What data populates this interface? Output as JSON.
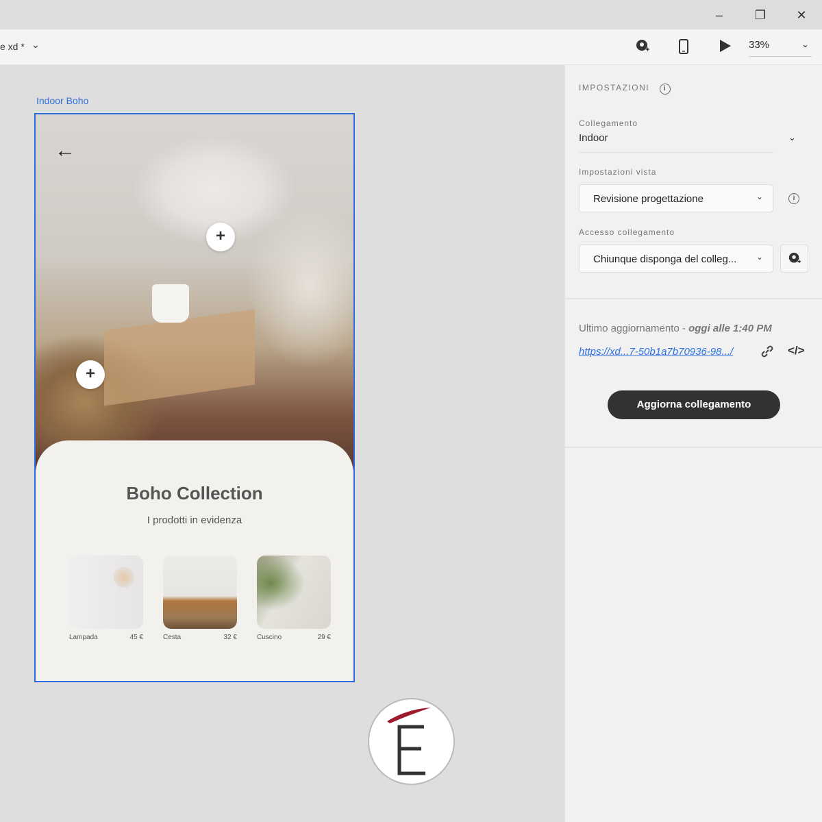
{
  "window": {
    "minimize": "–",
    "restore": "❐",
    "close": "✕"
  },
  "toolbar": {
    "doc_title": "e xd *",
    "doc_chevron": "⌄",
    "zoom": "33%",
    "zoom_chevron": "⌄"
  },
  "canvas": {
    "artboard_label": "Indoor Boho",
    "back_arrow": "←",
    "hotspot": "+",
    "title": "Boho Collection",
    "subtitle": "I prodotti in evidenza",
    "products": [
      {
        "name": "Lampada",
        "price": "45 €"
      },
      {
        "name": "Cesta",
        "price": "32 €"
      },
      {
        "name": "Cuscino",
        "price": "29 €"
      }
    ]
  },
  "panel": {
    "section_title": "IMPOSTAZIONI",
    "link_label": "Collegamento",
    "link_value": "Indoor",
    "view_label": "Impostazioni vista",
    "view_value": "Revisione progettazione",
    "access_label": "Accesso collegamento",
    "access_value": "Chiunque disponga del colleg...",
    "last_update": "Ultimo aggiornamento - ",
    "last_update_time": "oggi alle 1:40 PM",
    "url": "https://xd...7-50b1a7b70936-98.../",
    "embed": "</>",
    "update_button": "Aggiorna collegamento",
    "info": "i"
  },
  "logo": {
    "letter": "E"
  }
}
